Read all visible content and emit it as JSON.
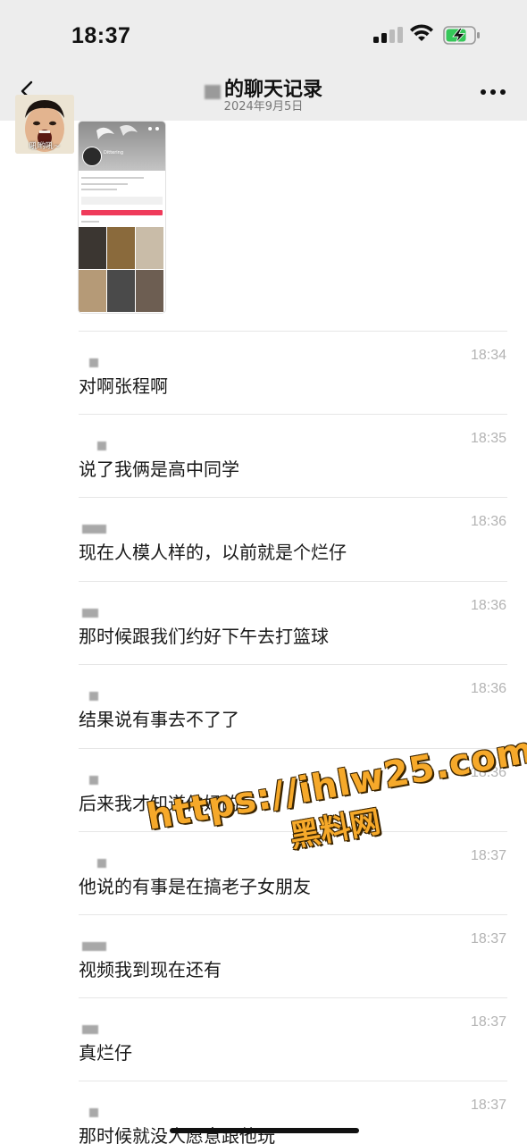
{
  "status_bar": {
    "time": "18:37"
  },
  "nav": {
    "title": "的聊天记录",
    "subtitle": "2024年9月5日",
    "back_icon": "chevron-left-icon",
    "more_icon": "ellipsis-icon"
  },
  "avatar": {
    "caption": "吼哟吼~"
  },
  "shared_image": {
    "profile_name": "Dittering"
  },
  "messages": [
    {
      "time": "18:34",
      "text": "对啊张程啊"
    },
    {
      "time": "18:35",
      "text": "说了我俩是高中同学"
    },
    {
      "time": "18:36",
      "text": "现在人模人样的，以前就是个烂仔"
    },
    {
      "time": "18:36",
      "text": "那时候跟我们约好下午去打篮球"
    },
    {
      "time": "18:36",
      "text": "结果说有事去不了了"
    },
    {
      "time": "18:36",
      "text": "后来我才知道他妈的"
    },
    {
      "time": "18:37",
      "text": "他说的有事是在搞老子女朋友"
    },
    {
      "time": "18:37",
      "text": "视频我到现在还有"
    },
    {
      "time": "18:37",
      "text": "真烂仔"
    },
    {
      "time": "18:37",
      "text": "那时候就没人愿意跟他玩"
    }
  ],
  "watermark": {
    "url": "https://ihlw25.com",
    "label": "黑料网"
  },
  "colors": {
    "header_bg": "#ededed",
    "time_gray": "#b3b3b3",
    "watermark_orange": "#f6a92a"
  }
}
